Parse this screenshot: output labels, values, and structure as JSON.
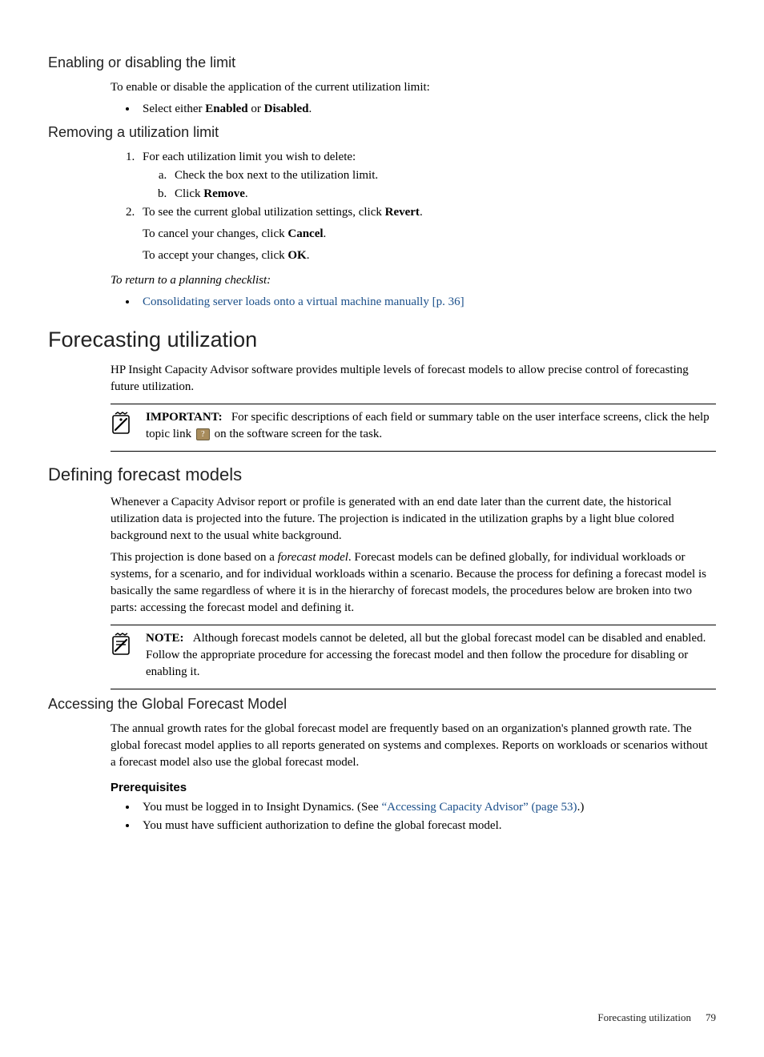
{
  "sections": {
    "enabling": {
      "title": "Enabling or disabling the limit",
      "intro": "To enable or disable the application of the current utilization limit:",
      "bullet1_pre": "Select either ",
      "enabled": "Enabled",
      "or": " or ",
      "disabled": "Disabled",
      "period": "."
    },
    "removing": {
      "title": "Removing a utilization limit",
      "step1": "For each utilization limit you wish to delete:",
      "step1a": "Check the box next to the utilization limit.",
      "step1b_pre": "Click ",
      "step1b_bold": "Remove",
      "step1b_post": ".",
      "step2_pre": "To see the current global utilization settings, click ",
      "step2_bold": "Revert",
      "step2_post": ".",
      "cancel_pre": "To cancel your changes, click ",
      "cancel_bold": "Cancel",
      "cancel_post": ".",
      "ok_pre": "To accept your changes, click ",
      "ok_bold": "OK",
      "ok_post": "."
    },
    "return": {
      "label": "To return to a planning checklist:",
      "link": "Consolidating server loads onto a virtual machine manually [p. 36]"
    },
    "forecasting": {
      "title": "Forecasting utilization",
      "p1": "HP Insight Capacity Advisor software provides multiple levels of forecast models to allow precise control of forecasting future utilization."
    },
    "important": {
      "label": "IMPORTANT:",
      "text_pre": "For specific descriptions of each field or summary table on the user interface screens, click the help topic link ",
      "text_post": " on the software screen for the task.",
      "badge": "?"
    },
    "defining": {
      "title": "Defining forecast models",
      "p1": "Whenever a Capacity Advisor report or profile is generated with an end date later than the current date, the historical utilization data is projected into the future. The projection is indicated in the utilization graphs by a light blue colored background next to the usual white background.",
      "p2_pre": "This projection is done based on a ",
      "p2_em": "forecast model",
      "p2_post": ". Forecast models can be defined globally, for individual workloads or systems, for a scenario, and for individual workloads within a scenario. Because the process for defining a forecast model is basically the same regardless of where it is in the hierarchy of forecast models, the procedures below are broken into two parts: accessing the forecast model and defining it."
    },
    "note": {
      "label": "NOTE:",
      "text": "Although forecast models cannot be deleted, all but the global forecast model can be disabled and enabled. Follow the appropriate procedure for accessing the forecast model and then follow the procedure for disabling or enabling it."
    },
    "accessing": {
      "title": "Accessing the Global Forecast Model",
      "p1": "The annual growth rates for the global forecast model are frequently based on an organization's planned growth rate. The global forecast model applies to all reports generated on systems and complexes. Reports on workloads or scenarios without a forecast model also use the global forecast model.",
      "prereq_title": "Prerequisites",
      "b1_pre": "You must be logged in to Insight Dynamics. (See ",
      "b1_link": "“Accessing Capacity Advisor” (page 53)",
      "b1_post": ".)",
      "b2": "You must have sufficient authorization to define the global forecast model."
    }
  },
  "footer": {
    "label": "Forecasting utilization",
    "page": "79"
  }
}
